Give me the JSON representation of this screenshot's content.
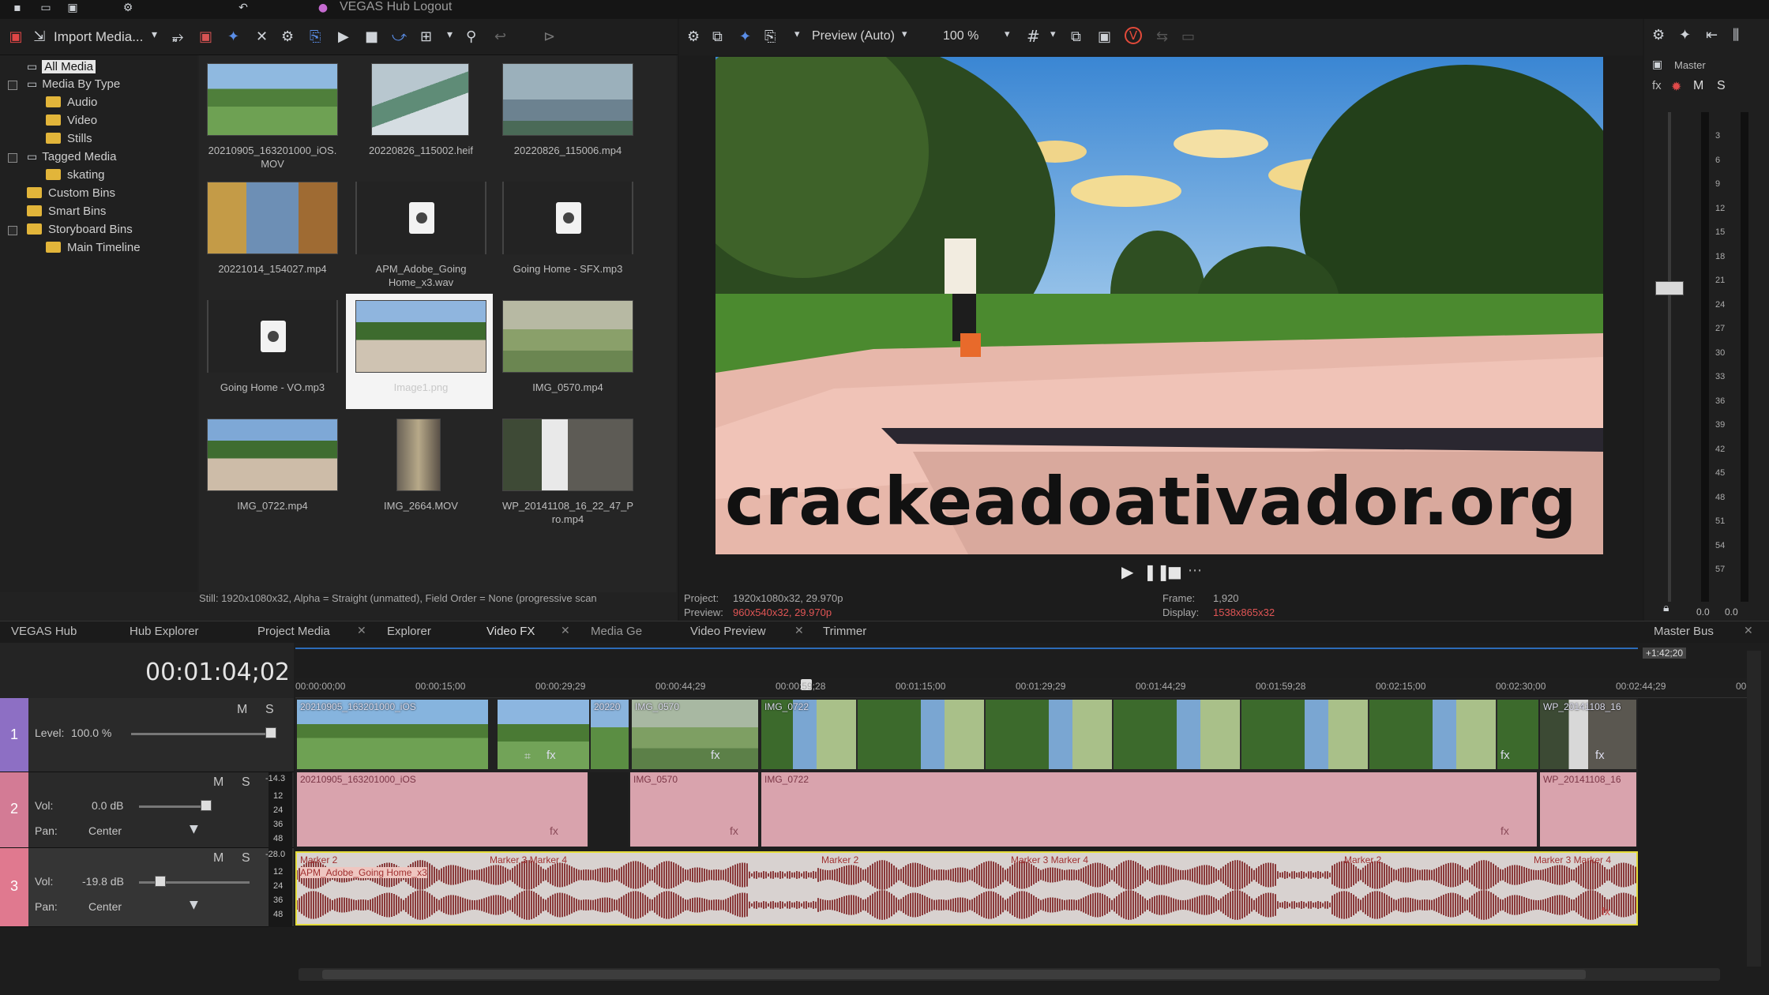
{
  "window": {
    "title": "VEGAS Hub Logout"
  },
  "media_toolbar": {
    "import_label": "Import Media..."
  },
  "tree": {
    "items": [
      "All Media",
      "Media By Type",
      "Audio",
      "Video",
      "Stills",
      "Tagged Media",
      "skating",
      "Custom Bins",
      "Smart Bins",
      "Storyboard Bins",
      "Main Timeline"
    ]
  },
  "media": [
    {
      "label": "20210905_163201000_iOS.\nMOV",
      "kind": "soccer"
    },
    {
      "label": "20220826_115002.heif",
      "kind": "waterfall"
    },
    {
      "label": "20220826_115006.mp4",
      "kind": "mist"
    },
    {
      "label": "20221014_154027.mp4",
      "kind": "person"
    },
    {
      "label": "APM_Adobe_Going\nHome_x3.wav",
      "kind": "audio"
    },
    {
      "label": "Going Home - SFX.mp3",
      "kind": "audio"
    },
    {
      "label": "Going Home - VO.mp3",
      "kind": "audio"
    },
    {
      "label": "Image1.png",
      "kind": "park"
    },
    {
      "label": "IMG_0570.mp4",
      "kind": "garden"
    },
    {
      "label": "IMG_0722.mp4",
      "kind": "park2"
    },
    {
      "label": "IMG_2664.MOV",
      "kind": "hall"
    },
    {
      "label": "WP_20141108_16_22_47_P\nro.mp4",
      "kind": "street"
    }
  ],
  "media_status": "Still: 1920x1080x32, Alpha = Straight (unmatted), Field Order = None (progressive scan",
  "preview_toolbar": {
    "preview_mode": "Preview (Auto)",
    "zoom": "100 %"
  },
  "preview_info": {
    "project_label": "Project:",
    "project_value": "1920x1080x32, 29.970p",
    "preview_label": "Preview:",
    "preview_value": "960x540x32, 29.970p",
    "frame_label": "Frame:",
    "frame_value": "1,920",
    "display_label": "Display:",
    "display_value": "1538x865x32"
  },
  "watermark": "crackeadoativador.org",
  "master": {
    "title": "Master",
    "m": "M",
    "s": "S",
    "scale": [
      "3",
      "6",
      "9",
      "12",
      "15",
      "18",
      "21",
      "24",
      "27",
      "30",
      "33",
      "36",
      "39",
      "42",
      "45",
      "48",
      "51",
      "54",
      "57"
    ],
    "left_val": "0.0",
    "right_val": "0.0"
  },
  "tabs": [
    "VEGAS Hub",
    "Hub Explorer",
    "Project Media",
    "Explorer",
    "Video FX",
    "Media Ge",
    "Video Preview",
    "Trimmer",
    "Master Bus"
  ],
  "timeline": {
    "timecode": "00:01:04;02",
    "end_badge": "+1:42;20",
    "ruler": [
      "00:00:00;00",
      "00:00:15;00",
      "00:00:29;29",
      "00:00:44;29",
      "00:00:59;28",
      "00:01:15;00",
      "00:01:29;29",
      "00:01:44;29",
      "00:01:59;28",
      "00:02:15;00",
      "00:02:30;00",
      "00:02:44;29",
      "00"
    ],
    "tracks": [
      {
        "num": "1",
        "m": "M",
        "s": "S",
        "level_label": "Level:",
        "level_value": "100.0 %"
      },
      {
        "num": "2",
        "m": "M",
        "s": "S",
        "vol_label": "Vol:",
        "vol_value": "0.0 dB",
        "pan_label": "Pan:",
        "pan_value": "Center",
        "db": "-14.3"
      },
      {
        "num": "3",
        "m": "M",
        "s": "S",
        "vol_label": "Vol:",
        "vol_value": "-19.8 dB",
        "pan_label": "Pan:",
        "pan_value": "Center",
        "db": "-28.0"
      }
    ],
    "meter_scale": [
      "12",
      "24",
      "36",
      "48"
    ],
    "video_clips": [
      "20210905_163201000_iOS",
      "",
      "20220",
      "IMG_0570",
      "IMG_0722",
      "",
      "",
      "",
      "",
      "",
      "WP_20141108_16"
    ],
    "audio2_clips": [
      "20210905_163201000_iOS",
      "IMG_0570",
      "IMG_0722",
      "WP_20141108_16"
    ],
    "audio3_clip": "APM_Adobe_Going Home_x3",
    "markers": [
      "Marker 2",
      "Marker 3 Marker 4",
      "Marker 2",
      "Marker 3 Marker 4",
      "Marker 2",
      "Marker 3 Marker 4"
    ],
    "fx": "fx"
  }
}
